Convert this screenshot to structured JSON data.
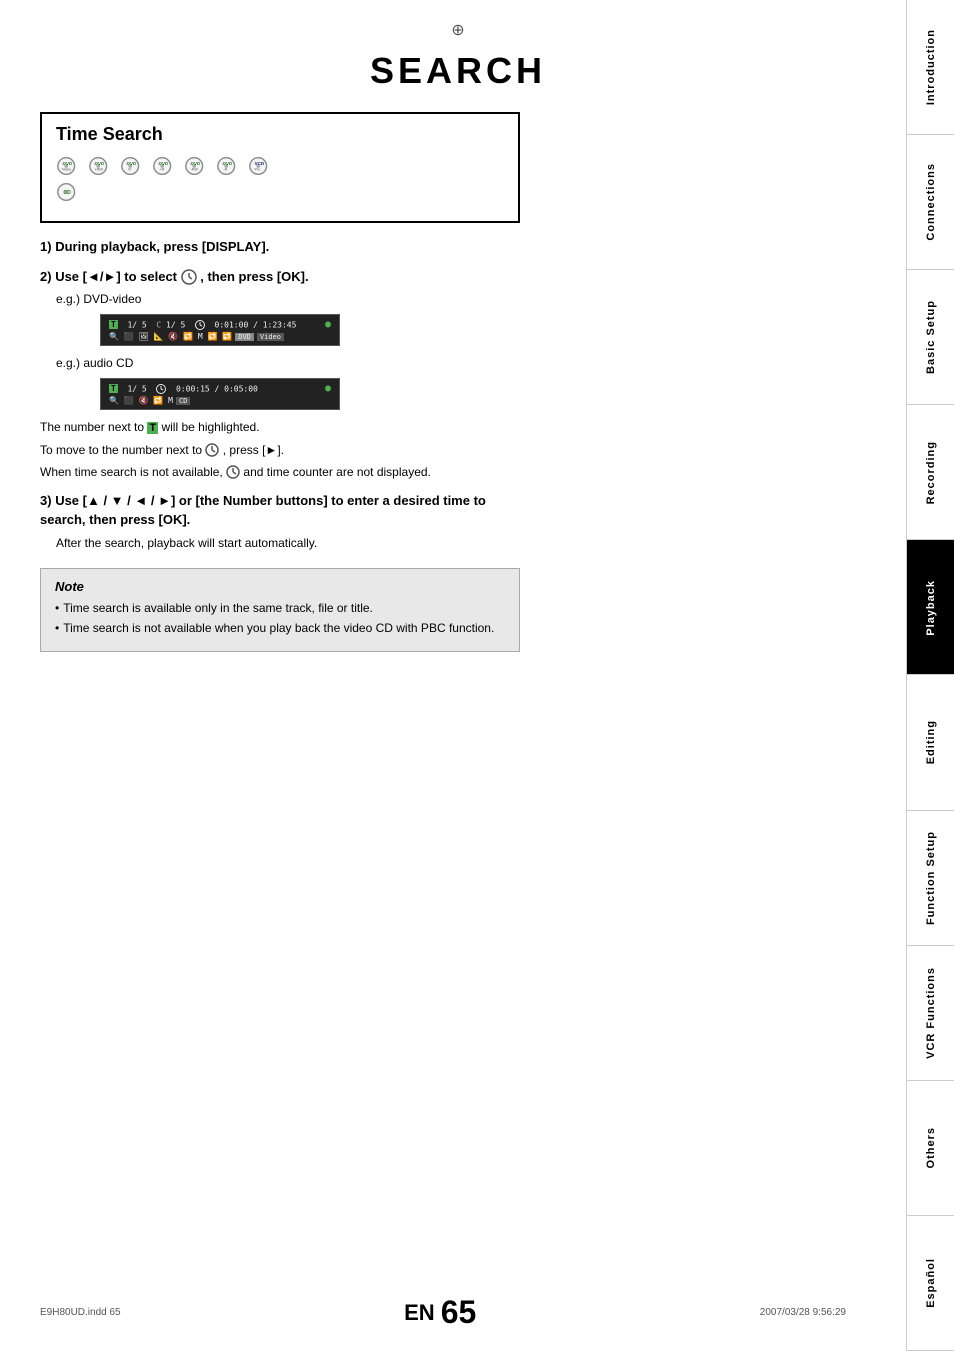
{
  "page": {
    "title": "SEARCH",
    "footer_file": "E9H80UD.indd  65",
    "footer_date": "2007/03/28  9:56:29",
    "page_number": "65",
    "en_label": "EN"
  },
  "section": {
    "title": "Time Search",
    "disc_types": [
      {
        "label": "DVD",
        "sub": "Video",
        "color": "green"
      },
      {
        "label": "DVD",
        "sub": "+RW",
        "color": "green"
      },
      {
        "label": "DVD",
        "sub": "R",
        "color": "green"
      },
      {
        "label": "DVD",
        "sub": "+R",
        "color": "green"
      },
      {
        "label": "DVD",
        "sub": "-RW",
        "color": "green"
      },
      {
        "label": "DVD",
        "sub": "-R",
        "color": "green"
      },
      {
        "label": "VCD",
        "sub": "Pro",
        "color": "blue"
      },
      {
        "label": "CD",
        "sub": "",
        "color": "green"
      }
    ]
  },
  "steps": {
    "step1": {
      "number": "1)",
      "text": "During playback, press [DISPLAY]."
    },
    "step2": {
      "number": "2)",
      "text": "Use [◄/►] to select",
      "text2": ", then press [OK].",
      "sub1_label": "e.g.) DVD-video",
      "sub2_label": "e.g.) audio CD",
      "display1_row1_left": "T  1/ 5  C  1/ 5  ⌚  0:01:00 / 1:23:45  ●",
      "display1_row2": "🔍 ⬛ 🖼 📐 🔇 🔁 M  🔁 🔁",
      "display1_badge": "DVD Video",
      "display2_row1": "T  1/ 5  ⌚  0:00:15 / 0:05:00  ●",
      "display2_badge": "CD",
      "highlight_note1": "The number next to",
      "highlight_note2": "will be highlighted.",
      "move_note1": "To move to the number next to",
      "move_note2": ", press [►].",
      "avail_note": "When time search is not available,",
      "avail_note2": "and time counter are not displayed."
    },
    "step3": {
      "number": "3)",
      "text": "Use [▲ / ▼ / ◄ / ►] or [the Number buttons] to enter a desired time to search, then press [OK].",
      "sub": "After the search, playback will start automatically."
    }
  },
  "note": {
    "title": "Note",
    "items": [
      "Time search is available only in the same track, file or title.",
      "Time search is not available when you play back the video CD with PBC function."
    ]
  },
  "sidebar": {
    "items": [
      {
        "label": "Introduction",
        "active": false
      },
      {
        "label": "Connections",
        "active": false
      },
      {
        "label": "Basic Setup",
        "active": false
      },
      {
        "label": "Recording",
        "active": false
      },
      {
        "label": "Playback",
        "active": true
      },
      {
        "label": "Editing",
        "active": false
      },
      {
        "label": "Function Setup",
        "active": false
      },
      {
        "label": "VCR Functions",
        "active": false
      },
      {
        "label": "Others",
        "active": false
      },
      {
        "label": "Español",
        "active": false
      }
    ]
  }
}
